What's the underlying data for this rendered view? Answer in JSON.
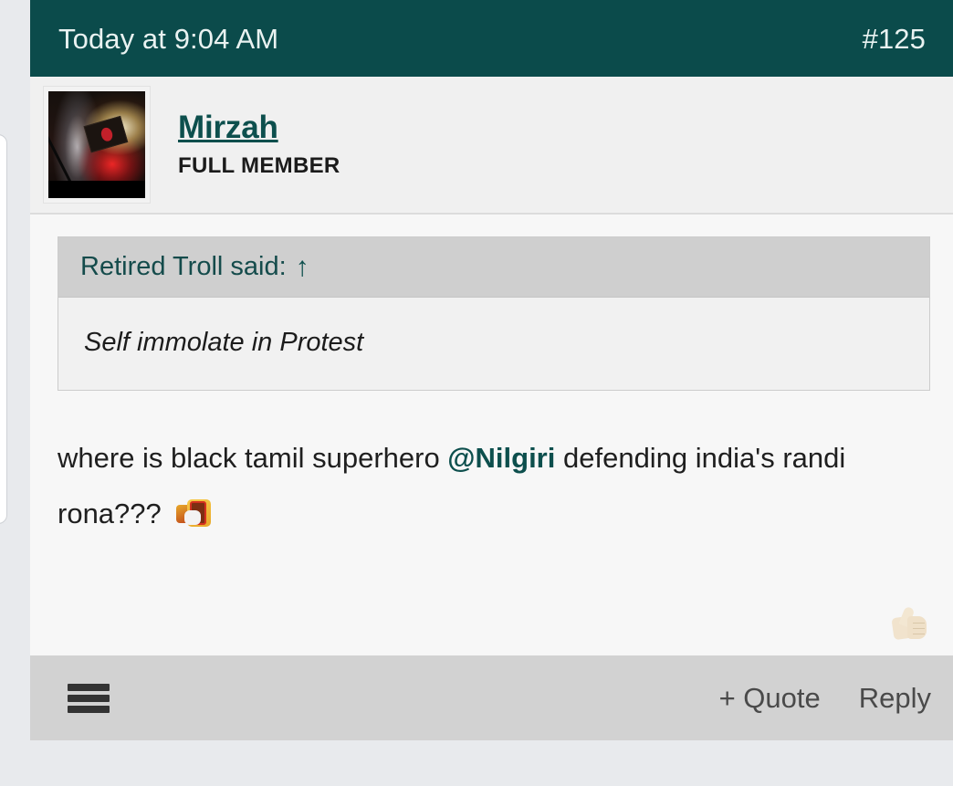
{
  "theme": {
    "header_bg": "#0b4b4b",
    "accent_teal": "#0d4f4d",
    "card_bg": "#f7f7f7",
    "page_bg": "#e8eaed",
    "footer_bg": "#d2d2d2",
    "quote_header_bg": "#cfcfcf"
  },
  "post": {
    "timestamp": "Today at 9:04 AM",
    "post_number": "#125",
    "author": {
      "name": "Mirzah",
      "title": "FULL MEMBER",
      "avatar_alt": "night fireworks with Bangladesh flag"
    },
    "quote": {
      "attribution": "Retired Troll said:",
      "jump_icon": "↑",
      "text": "Self immolate in Protest"
    },
    "message": {
      "part1": "where is black tamil superhero ",
      "mention": "@Nilgiri",
      "part2": " defending india's randi rona??? ",
      "emoji_name": "rofl-lol-emoji"
    },
    "reactions": [
      {
        "icon_name": "thumbs-up-emoji"
      }
    ]
  },
  "footer": {
    "menu_icon": "hamburger-menu-icon",
    "actions": [
      {
        "label": "+ Quote",
        "name": "quote-button"
      },
      {
        "label": "Reply",
        "name": "reply-button"
      }
    ]
  }
}
